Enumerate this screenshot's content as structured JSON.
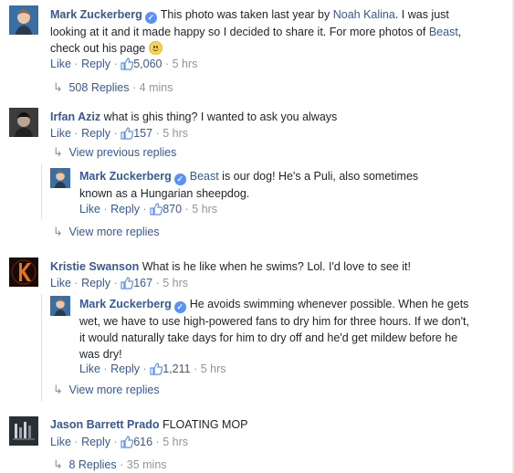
{
  "comments": [
    {
      "author": "Mark Zuckerberg",
      "text_prefix": "This photo was taken last year by ",
      "link1": "Noah Kalina",
      "text_mid": ". I was just looking at it and it made happy so I decided to share it. For more photos of ",
      "link2": "Beast",
      "text_suffix": ", check out his page",
      "like": "Like",
      "reply": "Reply",
      "likes": "5,060",
      "time": "5 hrs",
      "replies_link": "508 Replies",
      "replies_time": "4 mins"
    },
    {
      "author": "Irfan Aziz",
      "text": "what is ghis thing? I wanted to ask you always",
      "like": "Like",
      "reply": "Reply",
      "likes": "157",
      "time": "5 hrs",
      "view_previous": "View previous replies",
      "reply_item": {
        "author": "Mark Zuckerberg",
        "link": "Beast",
        "text": " is our dog! He's a Puli, also sometimes known as a Hungarian sheepdog.",
        "like": "Like",
        "reply": "Reply",
        "likes": "870",
        "time": "5 hrs"
      },
      "view_more": "View more replies"
    },
    {
      "author": "Kristie Swanson",
      "text": "What is he like when he swims? Lol. I'd love to see it!",
      "like": "Like",
      "reply": "Reply",
      "likes": "167",
      "time": "5 hrs",
      "reply_item": {
        "author": "Mark Zuckerberg",
        "text": "He avoids swimming whenever possible. When he gets wet, we have to use high-powered fans to dry him for three hours. If we don't, it would naturally take days for him to dry off and he'd get mildew before he was dry!",
        "like": "Like",
        "reply": "Reply",
        "likes": "1,211",
        "time": "5 hrs"
      },
      "view_more": "View more replies"
    },
    {
      "author": "Jason Barrett Prado",
      "text": "FLOATING MOP",
      "like": "Like",
      "reply": "Reply",
      "likes": "616",
      "time": "5 hrs",
      "replies_link": "8 Replies",
      "replies_time": "35 mins"
    }
  ],
  "separator": "·",
  "colors": {
    "link": "#365899",
    "meta": "#90949c",
    "verified": "#5890ff"
  }
}
